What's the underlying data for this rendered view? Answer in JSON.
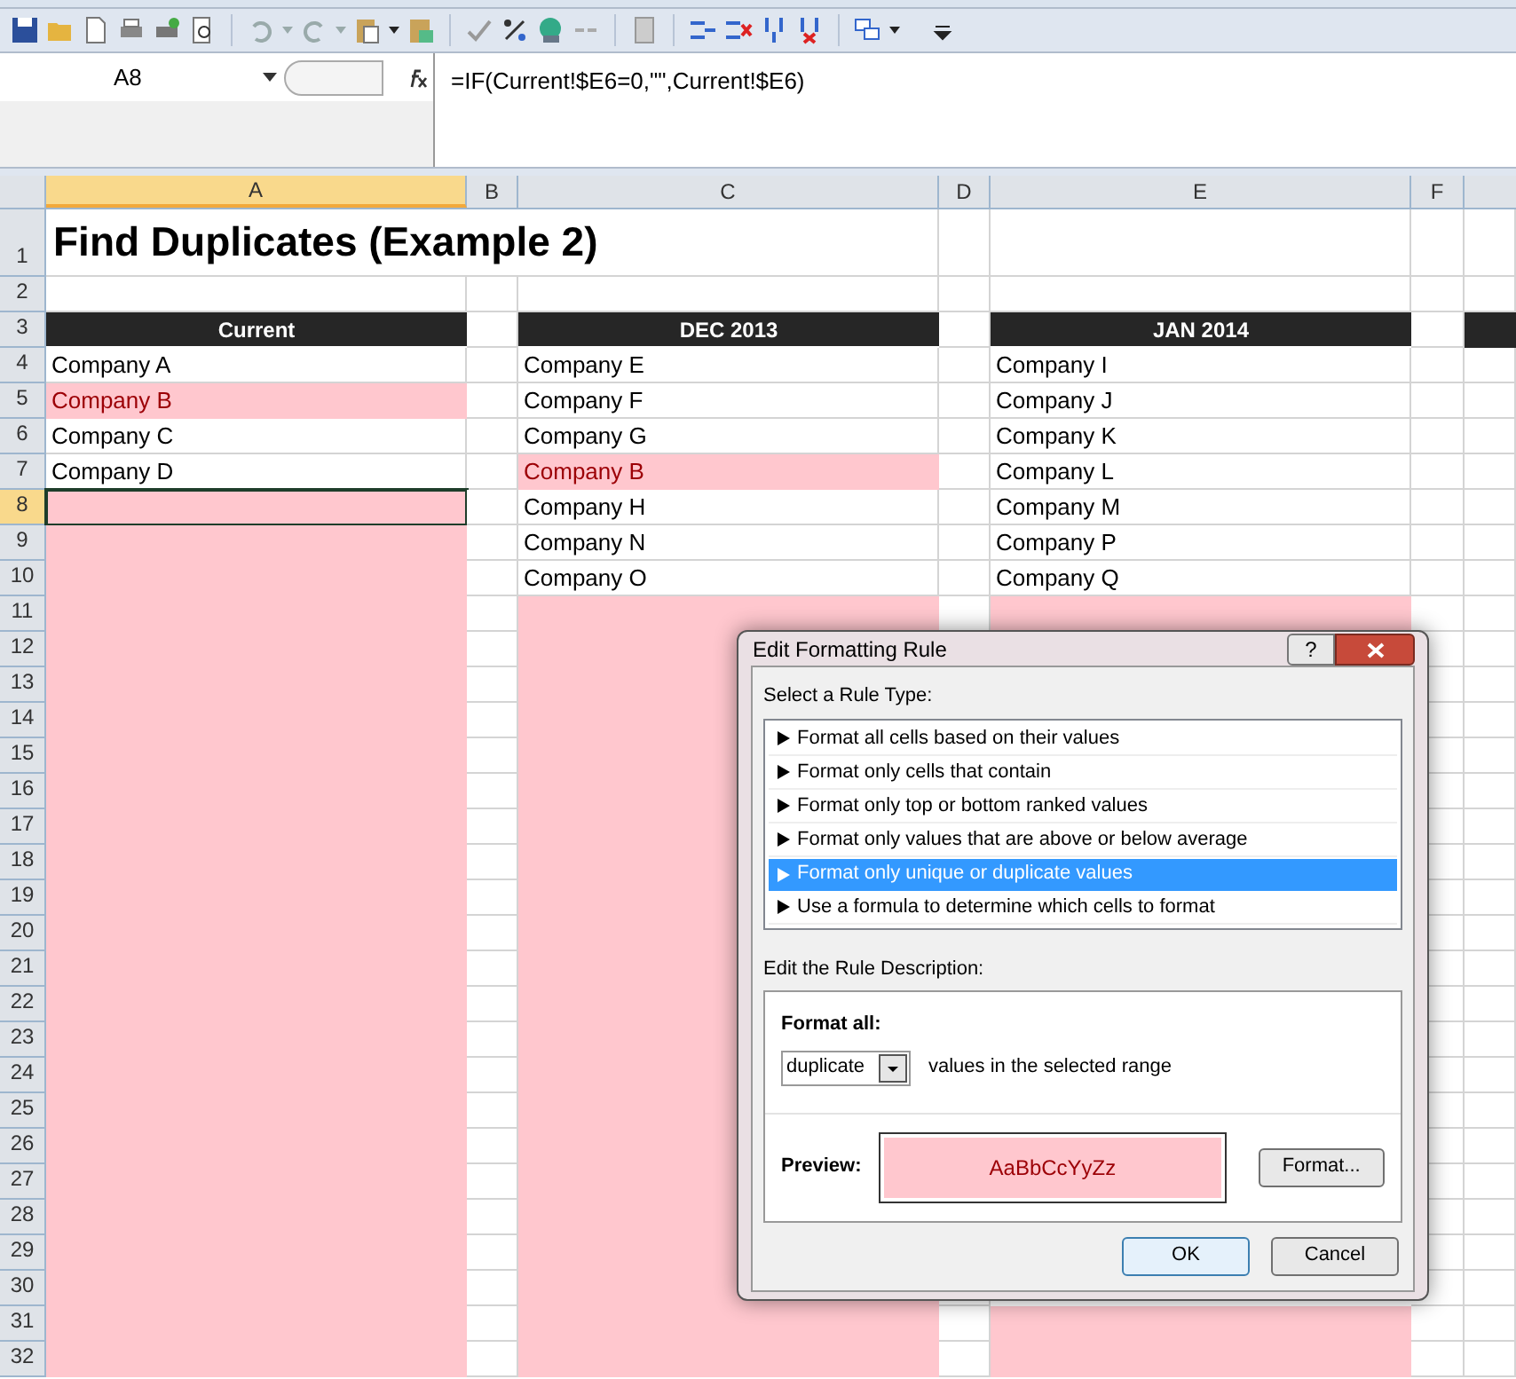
{
  "formula_bar": {
    "name_box": "A8",
    "formula": "=IF(Current!$E6=0,\"\",Current!$E6)"
  },
  "sheet": {
    "columns": [
      {
        "label": "A",
        "selected": true
      },
      {
        "label": "B",
        "selected": false
      },
      {
        "label": "C",
        "selected": false
      },
      {
        "label": "D",
        "selected": false
      },
      {
        "label": "E",
        "selected": false
      },
      {
        "label": "F",
        "selected": false
      }
    ],
    "rows": [
      {
        "number": "1",
        "selected": false,
        "kind": "title",
        "text": "Find Duplicates (Example 2)"
      },
      {
        "number": "2",
        "selected": false,
        "kind": "blank"
      },
      {
        "number": "3",
        "selected": false,
        "kind": "header",
        "cells": [
          "Current",
          "DEC 2013",
          "JAN 2014"
        ]
      },
      {
        "number": "4",
        "selected": false,
        "kind": "data",
        "cells": [
          {
            "text": "Company A",
            "highlighted": false
          },
          {
            "text": "Company E",
            "highlighted": false
          },
          {
            "text": "Company I",
            "highlighted": false
          }
        ]
      },
      {
        "number": "5",
        "selected": false,
        "kind": "data",
        "cells": [
          {
            "text": "Company B",
            "highlighted": true
          },
          {
            "text": "Company F",
            "highlighted": false
          },
          {
            "text": "Company J",
            "highlighted": false
          }
        ]
      },
      {
        "number": "6",
        "selected": false,
        "kind": "data",
        "cells": [
          {
            "text": "Company C",
            "highlighted": false
          },
          {
            "text": "Company G",
            "highlighted": false
          },
          {
            "text": "Company K",
            "highlighted": false
          }
        ]
      },
      {
        "number": "7",
        "selected": false,
        "kind": "data",
        "cells": [
          {
            "text": "Company D",
            "highlighted": false
          },
          {
            "text": "Company B",
            "highlighted": true
          },
          {
            "text": "Company L",
            "highlighted": false
          }
        ]
      },
      {
        "number": "8",
        "selected": true,
        "kind": "data",
        "cells": [
          {
            "highlighted": true
          },
          {
            "text": "Company H",
            "highlighted": false
          },
          {
            "text": "Company M",
            "highlighted": false
          }
        ]
      },
      {
        "number": "9",
        "selected": false,
        "kind": "data",
        "cells": [
          {
            "highlighted": true
          },
          {
            "text": "Company N",
            "highlighted": false
          },
          {
            "text": "Company P",
            "highlighted": false
          }
        ]
      },
      {
        "number": "10",
        "selected": false,
        "kind": "data",
        "cells": [
          {
            "highlighted": true
          },
          {
            "text": "Company O",
            "highlighted": false
          },
          {
            "text": "Company Q",
            "highlighted": false
          }
        ]
      },
      {
        "number": "11",
        "selected": false,
        "kind": "data",
        "cells": [
          {
            "highlighted": true
          },
          {
            "highlighted": true
          },
          {
            "highlighted": true
          }
        ]
      },
      {
        "number": "12",
        "selected": false,
        "kind": "data",
        "cells": [
          {
            "highlighted": true
          },
          {
            "highlighted": true
          }
        ]
      },
      {
        "number": "13",
        "selected": false,
        "kind": "data",
        "cells": [
          {
            "highlighted": true
          },
          {
            "highlighted": true
          }
        ]
      },
      {
        "number": "14",
        "selected": false,
        "kind": "data",
        "cells": [
          {
            "highlighted": true
          },
          {
            "highlighted": true
          }
        ]
      },
      {
        "number": "15",
        "selected": false,
        "kind": "data",
        "cells": [
          {
            "highlighted": true
          },
          {
            "highlighted": true
          }
        ]
      },
      {
        "number": "16",
        "selected": false,
        "kind": "data",
        "cells": [
          {
            "highlighted": true
          },
          {
            "highlighted": true
          }
        ]
      },
      {
        "number": "17",
        "selected": false,
        "kind": "data",
        "cells": [
          {
            "highlighted": true
          },
          {
            "highlighted": true
          }
        ]
      },
      {
        "number": "18",
        "selected": false,
        "kind": "data",
        "cells": [
          {
            "highlighted": true
          },
          {
            "highlighted": true
          }
        ]
      },
      {
        "number": "19",
        "selected": false,
        "kind": "data",
        "cells": [
          {
            "highlighted": true
          },
          {
            "highlighted": true
          }
        ]
      },
      {
        "number": "20",
        "selected": false,
        "kind": "data",
        "cells": [
          {
            "highlighted": true
          },
          {
            "highlighted": true
          }
        ]
      },
      {
        "number": "21",
        "selected": false,
        "kind": "data",
        "cells": [
          {
            "highlighted": true
          },
          {
            "highlighted": true
          }
        ]
      },
      {
        "number": "22",
        "selected": false,
        "kind": "data",
        "cells": [
          {
            "highlighted": true
          },
          {
            "highlighted": true
          }
        ]
      },
      {
        "number": "23",
        "selected": false,
        "kind": "data",
        "cells": [
          {
            "highlighted": true
          },
          {
            "highlighted": true
          }
        ]
      },
      {
        "number": "24",
        "selected": false,
        "kind": "data",
        "cells": [
          {
            "highlighted": true
          },
          {
            "highlighted": true
          }
        ]
      },
      {
        "number": "25",
        "selected": false,
        "kind": "data",
        "cells": [
          {
            "highlighted": true
          },
          {
            "highlighted": true
          }
        ]
      },
      {
        "number": "26",
        "selected": false,
        "kind": "data",
        "cells": [
          {
            "highlighted": true
          },
          {
            "highlighted": true
          }
        ]
      },
      {
        "number": "27",
        "selected": false,
        "kind": "data",
        "cells": [
          {
            "highlighted": true
          },
          {
            "highlighted": true
          }
        ]
      },
      {
        "number": "28",
        "selected": false,
        "kind": "data",
        "cells": [
          {
            "highlighted": true
          },
          {
            "highlighted": true
          }
        ]
      },
      {
        "number": "29",
        "selected": false,
        "kind": "data",
        "cells": [
          {
            "highlighted": true
          },
          {
            "highlighted": true
          }
        ]
      },
      {
        "number": "30",
        "selected": false,
        "kind": "data",
        "cells": [
          {
            "highlighted": true
          },
          {
            "highlighted": true
          }
        ]
      },
      {
        "number": "31",
        "selected": false,
        "kind": "data",
        "cells": [
          {
            "highlighted": true
          },
          {
            "highlighted": true
          },
          {
            "highlighted": true
          }
        ]
      },
      {
        "number": "32",
        "selected": false,
        "kind": "data",
        "cells": [
          {
            "highlighted": true
          },
          {
            "highlighted": true
          },
          {
            "highlighted": true
          }
        ]
      }
    ]
  },
  "dialog": {
    "title": "Edit Formatting Rule",
    "help": "?",
    "rule_type_label": "Select a Rule Type:",
    "rule_types": [
      {
        "label": "Format all cells based on their values",
        "selected": false
      },
      {
        "label": "Format only cells that contain",
        "selected": false
      },
      {
        "label": "Format only top or bottom ranked values",
        "selected": false
      },
      {
        "label": "Format only values that are above or below average",
        "selected": false
      },
      {
        "label": "Format only unique or duplicate values",
        "selected": true
      },
      {
        "label": "Use a formula to determine which cells to format",
        "selected": false
      }
    ],
    "description_label": "Edit the Rule Description:",
    "format_all_label": "Format all:",
    "dropdown_value": "duplicate",
    "range_text": "values in the selected range",
    "preview_label": "Preview:",
    "preview_sample": "AaBbCcYyZz",
    "format_button": "Format...",
    "ok_button": "OK",
    "cancel_button": "Cancel"
  }
}
